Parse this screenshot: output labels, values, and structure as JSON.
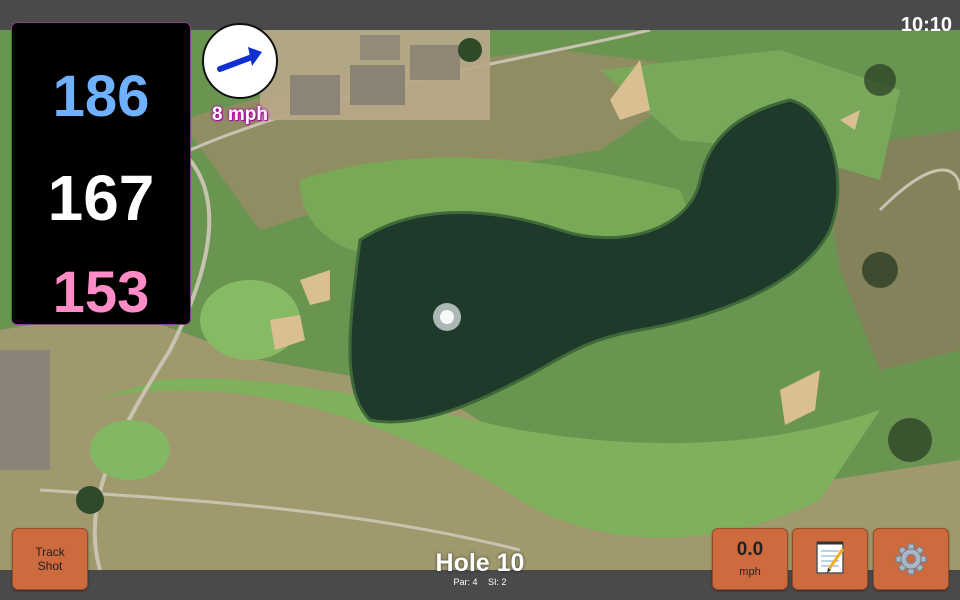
{
  "status": {
    "time": "10:10"
  },
  "distances": {
    "back": "186",
    "middle": "167",
    "front": "153"
  },
  "wind": {
    "speed_label": "8 mph",
    "direction_icon": "wind-arrow-icon"
  },
  "hole": {
    "title": "Hole 10",
    "par": "Par: 4",
    "stroke_index": "SI: 2"
  },
  "buttons": {
    "track_line1": "Track",
    "track_line2": "Shot",
    "speed_value": "0.0",
    "speed_unit": "mph",
    "notes_icon": "notepad-icon",
    "settings_icon": "gear-icon"
  },
  "colors": {
    "back": "#6fb0ff",
    "middle": "#ffffff",
    "front": "#ff8cc6",
    "button": "#cd6a3e",
    "bar": "#4a4a4a"
  }
}
